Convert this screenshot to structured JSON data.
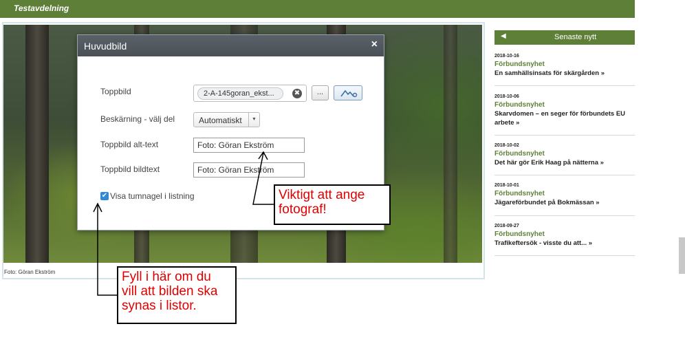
{
  "header": {
    "department": "Testavdelning"
  },
  "photo": {
    "credit": "Foto: Göran Ekström"
  },
  "dialog": {
    "title": "Huvudbild",
    "close_glyph": "×",
    "fields": {
      "topp_label": "Toppbild",
      "topp_value": "2-A-145goran_ekst...",
      "clear_glyph": "✖",
      "browse_label": "...",
      "crop_label": "Beskärning - välj del",
      "crop_value": "Automatiskt",
      "alt_label": "Toppbild alt-text",
      "alt_value": "Foto: Göran Ekström",
      "caption_label": "Toppbild bildtext",
      "caption_value": "Foto: Göran Ekström",
      "thumb_label": "Visa tumnagel i listning",
      "thumb_checked": true
    }
  },
  "callouts": {
    "photographer_line1": "Viktigt att ange",
    "photographer_line2": "fotograf!",
    "list_line1": "Fyll i här om du",
    "list_line2": "vill att bilden ska",
    "list_line3": "synas i listor."
  },
  "sidebar": {
    "title": "Senaste nytt",
    "items": [
      {
        "date": "2018-10-16",
        "category": "Förbundsnyhet",
        "title": "En samhällsinsats för skärgården »"
      },
      {
        "date": "2018-10-06",
        "category": "Förbundsnyhet",
        "title": "Skarvdomen – en seger för förbundets EU arbete »"
      },
      {
        "date": "2018-10-02",
        "category": "Förbundsnyhet",
        "title": "Det här gör Erik Haag på nätterna »"
      },
      {
        "date": "2018-10-01",
        "category": "Förbundsnyhet",
        "title": "Jägareförbundet på Bokmässan »"
      },
      {
        "date": "2018-09-27",
        "category": "Förbundsnyhet",
        "title": "Trafikeftersök - visste du att... »"
      }
    ]
  },
  "colors": {
    "brand_green": "#5e7f38",
    "callout_red": "#e00000"
  }
}
